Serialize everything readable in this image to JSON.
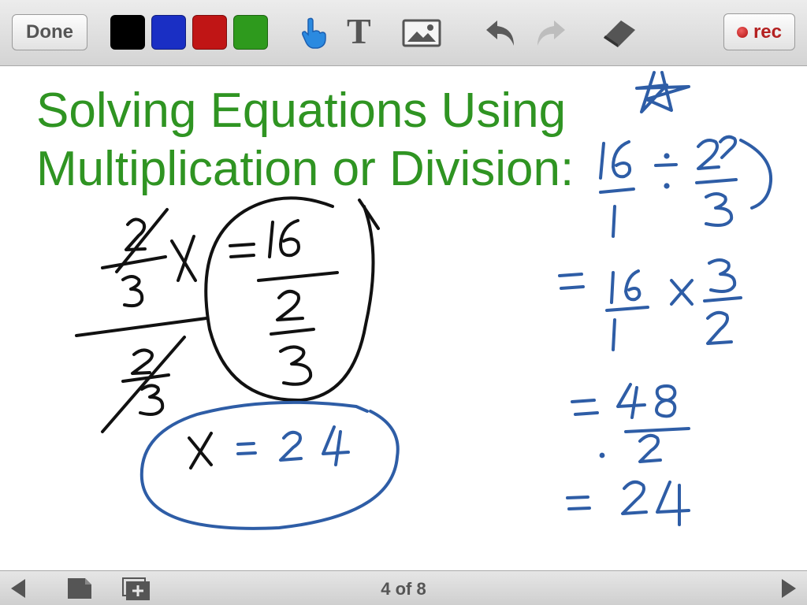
{
  "toolbar": {
    "done_label": "Done",
    "rec_label": "rec",
    "colors": [
      {
        "name": "black",
        "hex": "#000000"
      },
      {
        "name": "blue",
        "hex": "#1a2fc4"
      },
      {
        "name": "red",
        "hex": "#c01515"
      },
      {
        "name": "green",
        "hex": "#2e9a1d"
      }
    ],
    "tools": [
      "pointer-hand-icon",
      "text-tool-icon",
      "image-icon",
      "undo-icon",
      "redo-icon",
      "eraser-icon"
    ]
  },
  "whiteboard": {
    "title_line1": "Solving Equations Using",
    "title_line2": "Multiplication or Division:",
    "title_color": "#2f9422",
    "ink_black": "#111111",
    "ink_blue": "#2e5da6"
  },
  "footer": {
    "page_indicator": "4 of 8",
    "icons": [
      "prev-page-icon",
      "page-icon",
      "add-page-icon",
      "next-page-icon"
    ]
  }
}
